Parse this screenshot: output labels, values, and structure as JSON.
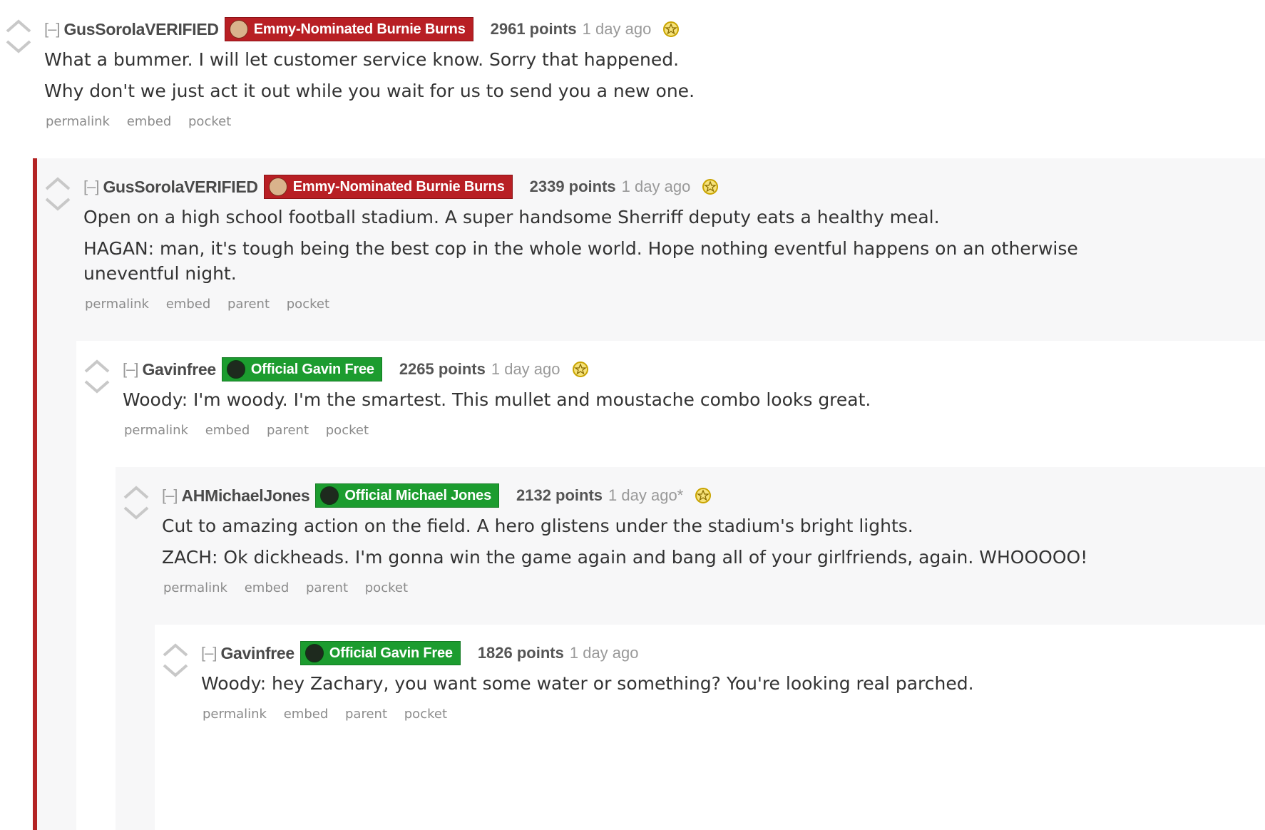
{
  "comments": [
    {
      "author": "GusSorolaVERIFIED",
      "toggle": "[–]",
      "flair": "Emmy-Nominated Burnie Burns",
      "flair_color": "#b81f24",
      "points": "2961 points",
      "time": "1 day ago",
      "gilded": true,
      "paragraphs": [
        "What a bummer. I will let customer service know. Sorry that happened.",
        "Why don't we just act it out while you wait for us to send you a new one."
      ],
      "links": [
        "permalink",
        "embed",
        "pocket"
      ]
    },
    {
      "author": "GusSorolaVERIFIED",
      "toggle": "[–]",
      "flair": "Emmy-Nominated Burnie Burns",
      "flair_color": "#b81f24",
      "points": "2339 points",
      "time": "1 day ago",
      "gilded": true,
      "paragraphs": [
        "Open on a high school football stadium. A super handsome Sherriff deputy eats a healthy meal.",
        "HAGAN: man, it's tough being the best cop in the whole world. Hope nothing eventful happens on an otherwise uneventful night."
      ],
      "links": [
        "permalink",
        "embed",
        "parent",
        "pocket"
      ]
    },
    {
      "author": "Gavinfree",
      "toggle": "[–]",
      "flair": "Official Gavin Free",
      "flair_color": "#1c9c2f",
      "points": "2265 points",
      "time": "1 day ago",
      "gilded": true,
      "paragraphs": [
        "Woody: I'm woody. I'm the smartest. This mullet and moustache combo looks great."
      ],
      "links": [
        "permalink",
        "embed",
        "parent",
        "pocket"
      ]
    },
    {
      "author": "AHMichaelJones",
      "toggle": "[–]",
      "flair": "Official Michael Jones",
      "flair_color": "#1c9c2f",
      "points": "2132 points",
      "time": "1 day ago*",
      "gilded": true,
      "paragraphs": [
        "Cut to amazing action on the field. A hero glistens under the stadium's bright lights.",
        "ZACH: Ok dickheads. I'm gonna win the game again and bang all of your girlfriends, again. WHOOOOO!"
      ],
      "links": [
        "permalink",
        "embed",
        "parent",
        "pocket"
      ]
    },
    {
      "author": "Gavinfree",
      "toggle": "[–]",
      "flair": "Official Gavin Free",
      "flair_color": "#1c9c2f",
      "points": "1826 points",
      "time": "1 day ago",
      "gilded": false,
      "paragraphs": [
        "Woody: hey Zachary, you want some water or something? You're looking real parched."
      ],
      "links": [
        "permalink",
        "embed",
        "parent",
        "pocket"
      ]
    }
  ],
  "colors": {
    "nest_bar": "#b32323",
    "gild": "#e0b400"
  },
  "icons": [
    "upvote-arrow-icon",
    "downvote-arrow-icon",
    "gold-star-icon",
    "flair-avatar-icon"
  ]
}
